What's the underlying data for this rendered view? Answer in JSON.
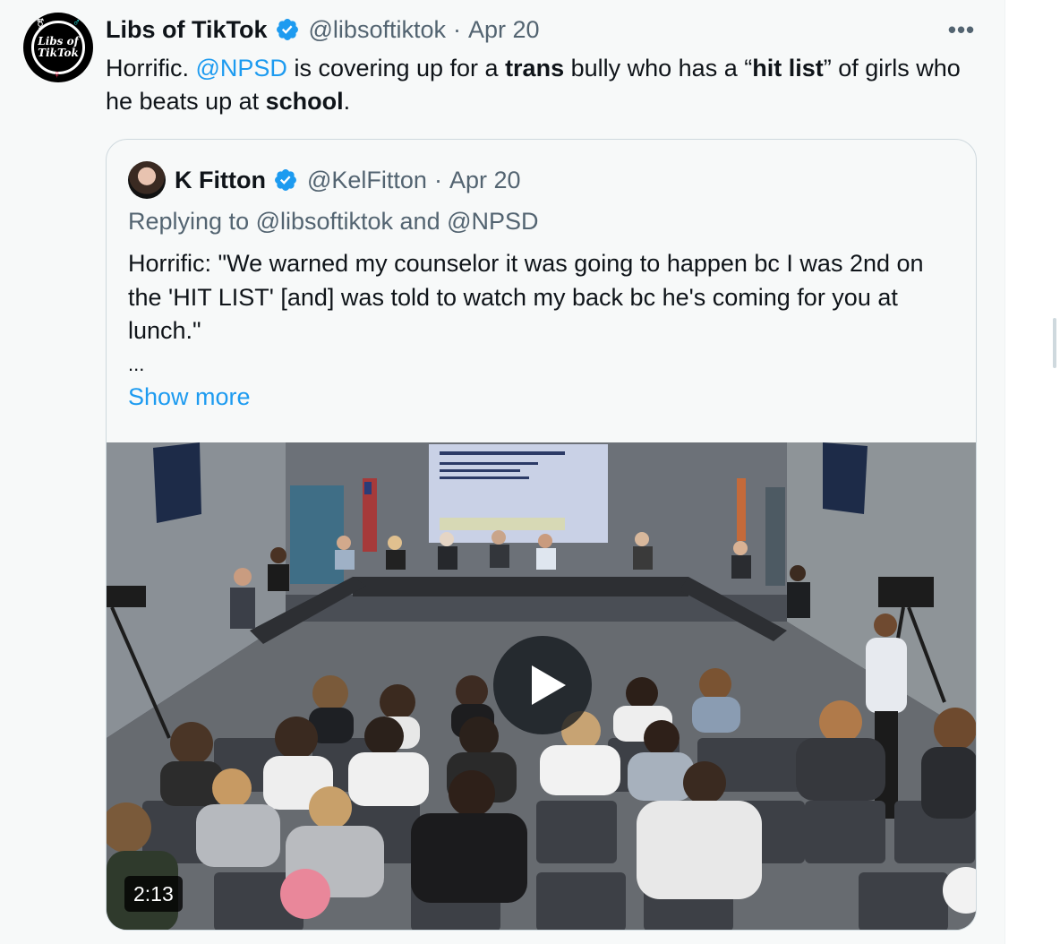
{
  "tweet": {
    "author_name": "Libs of TikTok",
    "author_handle": "@libsoftiktok",
    "separator": "·",
    "date": "Apr 20",
    "more_label": "•••",
    "avatar_text_1": "Libs of",
    "avatar_text_2": "TikTok",
    "text_parts": {
      "p1": "Horrific. ",
      "mention": "@NPSD",
      "p2": " is covering up for a ",
      "b1": "trans",
      "p3": " bully who has a “",
      "b2": "hit list",
      "p4": "” of girls who he beats up at ",
      "b3": "school",
      "p5": "."
    }
  },
  "quote": {
    "author_name": "K Fitton",
    "author_handle": "@KelFitton",
    "separator": "·",
    "date": "Apr 20",
    "replying_to": "Replying to @libsoftiktok and @NPSD",
    "body": "Horrific: \"We warned my counselor it was going to happen bc I was 2nd on the 'HIT LIST' [and] was told to watch my back bc he's coming for you at lunch.\"",
    "ellipsis": "...",
    "show_more": "Show more",
    "video_duration": "2:13"
  },
  "colors": {
    "accent": "#1d9bf0",
    "secondary_text": "#536471",
    "verified": "#1d9bf0"
  }
}
